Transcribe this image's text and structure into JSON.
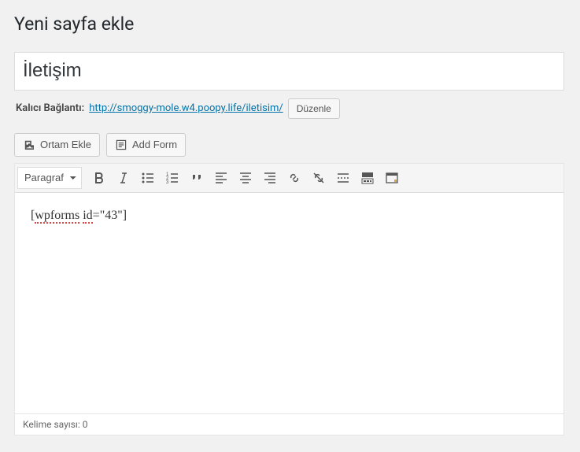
{
  "heading": "Yeni sayfa ekle",
  "title_value": "İletişim",
  "permalink": {
    "label": "Kalıcı Bağlantı:",
    "url_text": "http://smoggy-mole.w4.poopy.life/iletisim/",
    "edit_label": "Düzenle"
  },
  "buttons": {
    "media": "Ortam Ekle",
    "add_form": "Add Form"
  },
  "toolbar": {
    "format_selected": "Paragraf"
  },
  "editor_body": "[wpforms id=\"43\"]",
  "footer": {
    "word_count_label": "Kelime sayısı:",
    "word_count": "0"
  }
}
